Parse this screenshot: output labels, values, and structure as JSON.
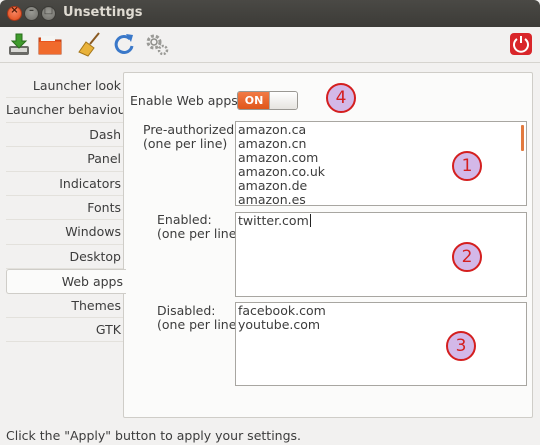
{
  "window": {
    "title": "Unsettings"
  },
  "toolbar": {
    "icons": [
      "download-save-icon",
      "folder-icon",
      "broom-clean-icon",
      "refresh-icon",
      "settings-gear-icon",
      "power-icon"
    ]
  },
  "sidebar": {
    "items": [
      {
        "label": "Launcher look"
      },
      {
        "label": "Launcher behaviour"
      },
      {
        "label": "Dash"
      },
      {
        "label": "Panel"
      },
      {
        "label": "Indicators"
      },
      {
        "label": "Fonts"
      },
      {
        "label": "Windows"
      },
      {
        "label": "Desktop"
      },
      {
        "label": "Web apps",
        "active": true
      },
      {
        "label": "Themes"
      },
      {
        "label": "GTK"
      }
    ]
  },
  "webapps": {
    "enable_label": "Enable Web apps:",
    "toggle_state": "ON",
    "preauthorized": {
      "label": "Pre-authorized:\n(one per line)",
      "lines": [
        "amazon.ca",
        "amazon.cn",
        "amazon.com",
        "amazon.co.uk",
        "amazon.de",
        "amazon.es"
      ]
    },
    "enabled": {
      "label": "Enabled:\n(one per line)",
      "lines": [
        "twitter.com"
      ]
    },
    "disabled": {
      "label": "Disabled:\n(one per line)",
      "lines": [
        "facebook.com",
        "youtube.com"
      ]
    }
  },
  "annotations": {
    "m1": "1",
    "m2": "2",
    "m3": "3",
    "m4": "4"
  },
  "colors": {
    "accent": "#e0571b",
    "titlebar": "#3c3b37",
    "annotation_red": "#d41f1f",
    "annotation_fill": "#d3b8e8"
  },
  "statusbar": {
    "text": "Click the \"Apply\" button to apply your settings."
  }
}
